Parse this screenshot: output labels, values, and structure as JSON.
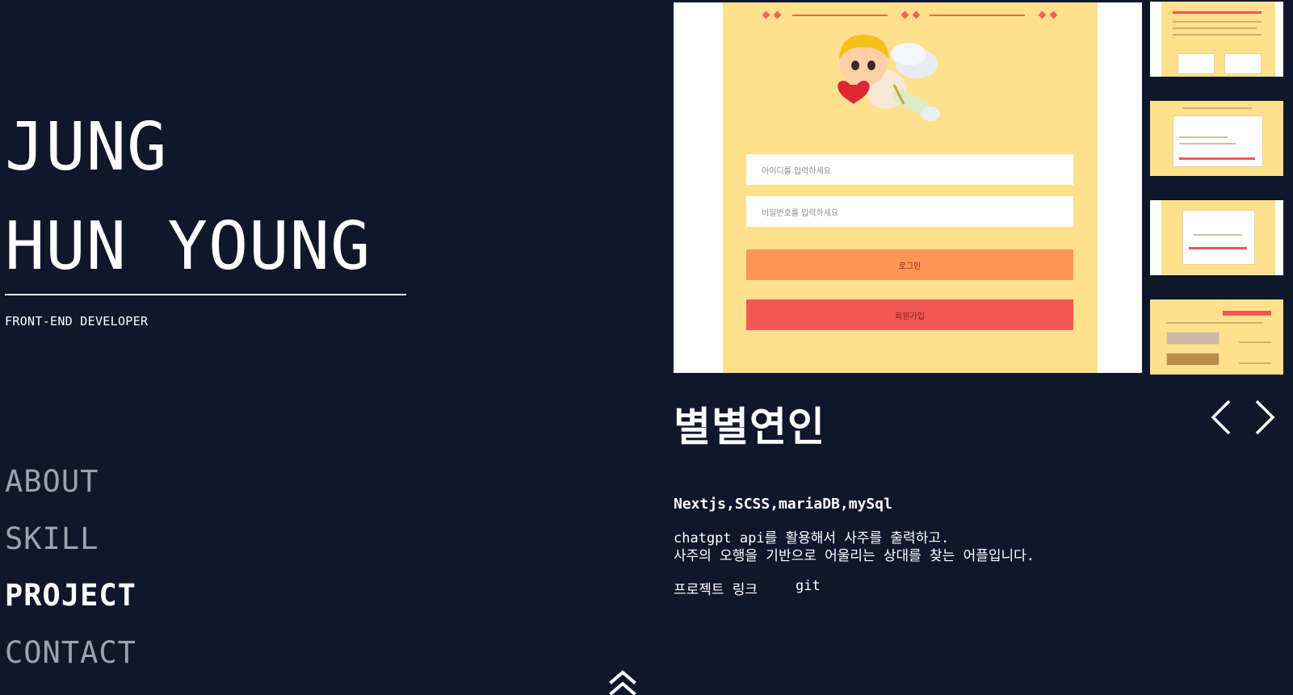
{
  "profile": {
    "name_line_1": "JUNG",
    "name_line_2": "HUN YOUNG",
    "role": "FRONT-END DEVELOPER"
  },
  "nav": {
    "items": [
      {
        "label": "ABOUT"
      },
      {
        "label": "SKILL"
      },
      {
        "label": "PROJECT",
        "active": true
      },
      {
        "label": "CONTACT"
      }
    ]
  },
  "preview": {
    "id_placeholder": "아이디를 입력하세요",
    "pw_placeholder": "비밀번호를 입력하세요",
    "login_label": "로그인",
    "signup_label": "회원가입"
  },
  "project": {
    "title": "별별연인",
    "stack": "Nextjs,SCSS,mariaDB,mySql",
    "description": "chatgpt api를 활용해서 사주를 출력하고.\n사주의 오행을 기반으로 어울리는 상대를 찾는 어플입니다.",
    "link_project": "프로젝트 링크",
    "link_git": "git"
  },
  "colors": {
    "background": "#0f172a",
    "panel_yellow": "#ffe08d",
    "login_orange": "#fe9555",
    "signup_red": "#f25754"
  },
  "icons": {
    "prev": "chevron-left-icon",
    "next": "chevron-right-icon",
    "scroll_top": "double-chevron-up-icon"
  }
}
